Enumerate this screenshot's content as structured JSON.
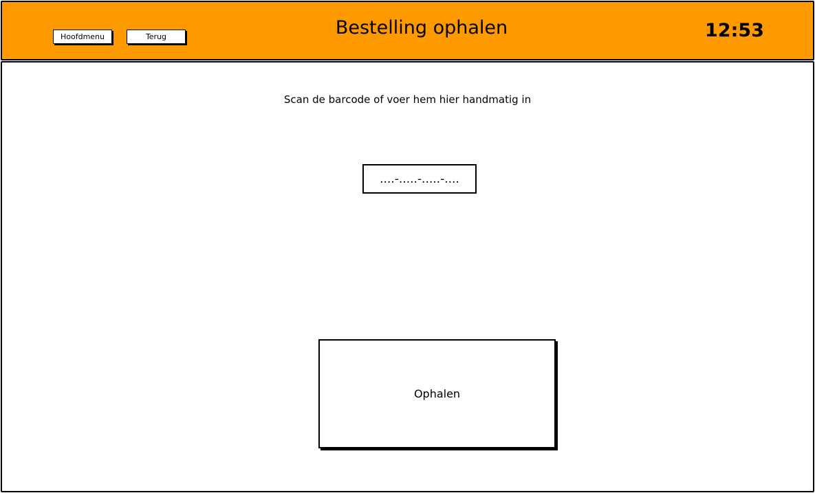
{
  "header": {
    "title": "Bestelling ophalen",
    "clock": "12:53",
    "main_menu_label": "Hoofdmenu",
    "back_label": "Terug",
    "background_color": "#ff9900"
  },
  "main": {
    "instruction": "Scan de barcode of voer hem hier handmatig in",
    "barcode_placeholder": "....-.....-.....-....",
    "fetch_label": "Ophalen"
  }
}
